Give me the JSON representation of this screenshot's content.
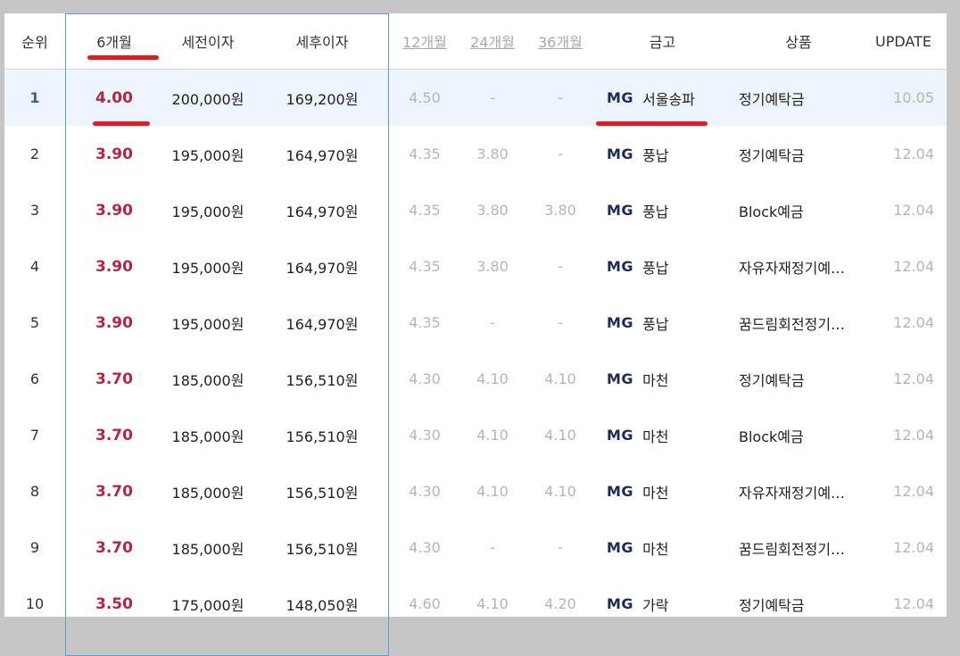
{
  "header": {
    "rank": "순위",
    "m6": "6개월",
    "pre_tax": "세전이자",
    "post_tax": "세후이자",
    "m12": "12개월",
    "m24": "24개월",
    "m36": "36개월",
    "bank": "금고",
    "product": "상품",
    "update": "UPDATE"
  },
  "rows": [
    {
      "rank": "1",
      "m6": "4.00",
      "pre": "200,000원",
      "post": "169,200원",
      "m12": "4.50",
      "m24": "-",
      "m36": "-",
      "logo": "MG",
      "bank": "서울송파",
      "product": "정기예탁금",
      "update": "10.05"
    },
    {
      "rank": "2",
      "m6": "3.90",
      "pre": "195,000원",
      "post": "164,970원",
      "m12": "4.35",
      "m24": "3.80",
      "m36": "-",
      "logo": "MG",
      "bank": "풍납",
      "product": "정기예탁금",
      "update": "12.04"
    },
    {
      "rank": "3",
      "m6": "3.90",
      "pre": "195,000원",
      "post": "164,970원",
      "m12": "4.35",
      "m24": "3.80",
      "m36": "3.80",
      "logo": "MG",
      "bank": "풍납",
      "product": "Block예금",
      "update": "12.04"
    },
    {
      "rank": "4",
      "m6": "3.90",
      "pre": "195,000원",
      "post": "164,970원",
      "m12": "4.35",
      "m24": "3.80",
      "m36": "-",
      "logo": "MG",
      "bank": "풍납",
      "product": "자유자재정기예…",
      "update": "12.04"
    },
    {
      "rank": "5",
      "m6": "3.90",
      "pre": "195,000원",
      "post": "164,970원",
      "m12": "4.35",
      "m24": "-",
      "m36": "-",
      "logo": "MG",
      "bank": "풍납",
      "product": "꿈드림회전정기…",
      "update": "12.04"
    },
    {
      "rank": "6",
      "m6": "3.70",
      "pre": "185,000원",
      "post": "156,510원",
      "m12": "4.30",
      "m24": "4.10",
      "m36": "4.10",
      "logo": "MG",
      "bank": "마천",
      "product": "정기예탁금",
      "update": "12.04"
    },
    {
      "rank": "7",
      "m6": "3.70",
      "pre": "185,000원",
      "post": "156,510원",
      "m12": "4.30",
      "m24": "4.10",
      "m36": "4.10",
      "logo": "MG",
      "bank": "마천",
      "product": "Block예금",
      "update": "12.04"
    },
    {
      "rank": "8",
      "m6": "3.70",
      "pre": "185,000원",
      "post": "156,510원",
      "m12": "4.30",
      "m24": "4.10",
      "m36": "4.10",
      "logo": "MG",
      "bank": "마천",
      "product": "자유자재정기예…",
      "update": "12.04"
    },
    {
      "rank": "9",
      "m6": "3.70",
      "pre": "185,000원",
      "post": "156,510원",
      "m12": "4.30",
      "m24": "-",
      "m36": "-",
      "logo": "MG",
      "bank": "마천",
      "product": "꿈드림회전정기…",
      "update": "12.04"
    },
    {
      "rank": "10",
      "m6": "3.50",
      "pre": "175,000원",
      "post": "148,050원",
      "m12": "4.60",
      "m24": "4.10",
      "m36": "4.20",
      "logo": "MG",
      "bank": "가락",
      "product": "정기예탁금",
      "update": "12.04"
    }
  ],
  "colors": {
    "rate_accent": "#b8243f",
    "frame_blue": "#5b9bd8",
    "annotation_red": "#e31b23",
    "highlight_row": "#eef4fc"
  }
}
